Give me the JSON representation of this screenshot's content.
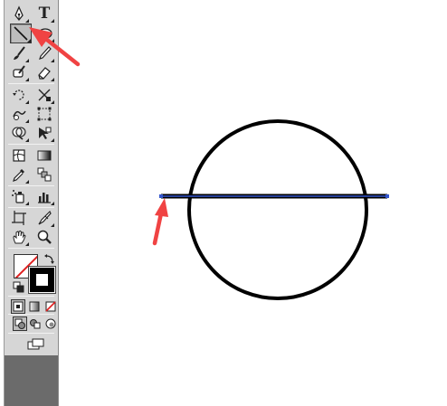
{
  "toolbar": {
    "type_tool_label": "T",
    "tools": [
      "pen-tool-icon",
      "type-tool-icon",
      "line-segment-tool-icon",
      "ellipse-tool-icon",
      "paintbrush-tool-icon",
      "pencil-tool-icon",
      "blob-brush-tool-icon",
      "eraser-tool-icon",
      "rotate-tool-icon",
      "scale-tool-icon",
      "warp-tool-icon",
      "free-transform-tool-icon",
      "shape-builder-tool-icon",
      "live-paint-tool-icon",
      "mesh-tool-icon",
      "gradient-tool-icon",
      "eyedropper-tool-icon",
      "blend-tool-icon",
      "symbol-sprayer-tool-icon",
      "column-graph-tool-icon",
      "artboard-tool-icon",
      "slice-tool-icon",
      "hand-tool-icon",
      "zoom-tool-icon"
    ],
    "selected_tool": "line-segment-tool-icon",
    "fill_color": "none",
    "stroke_color": "#000000"
  },
  "canvas": {
    "circle_stroke_color": "#000000",
    "line_segment_color": "#3355cc",
    "annotation_arrow_color": "#f03a3a"
  }
}
